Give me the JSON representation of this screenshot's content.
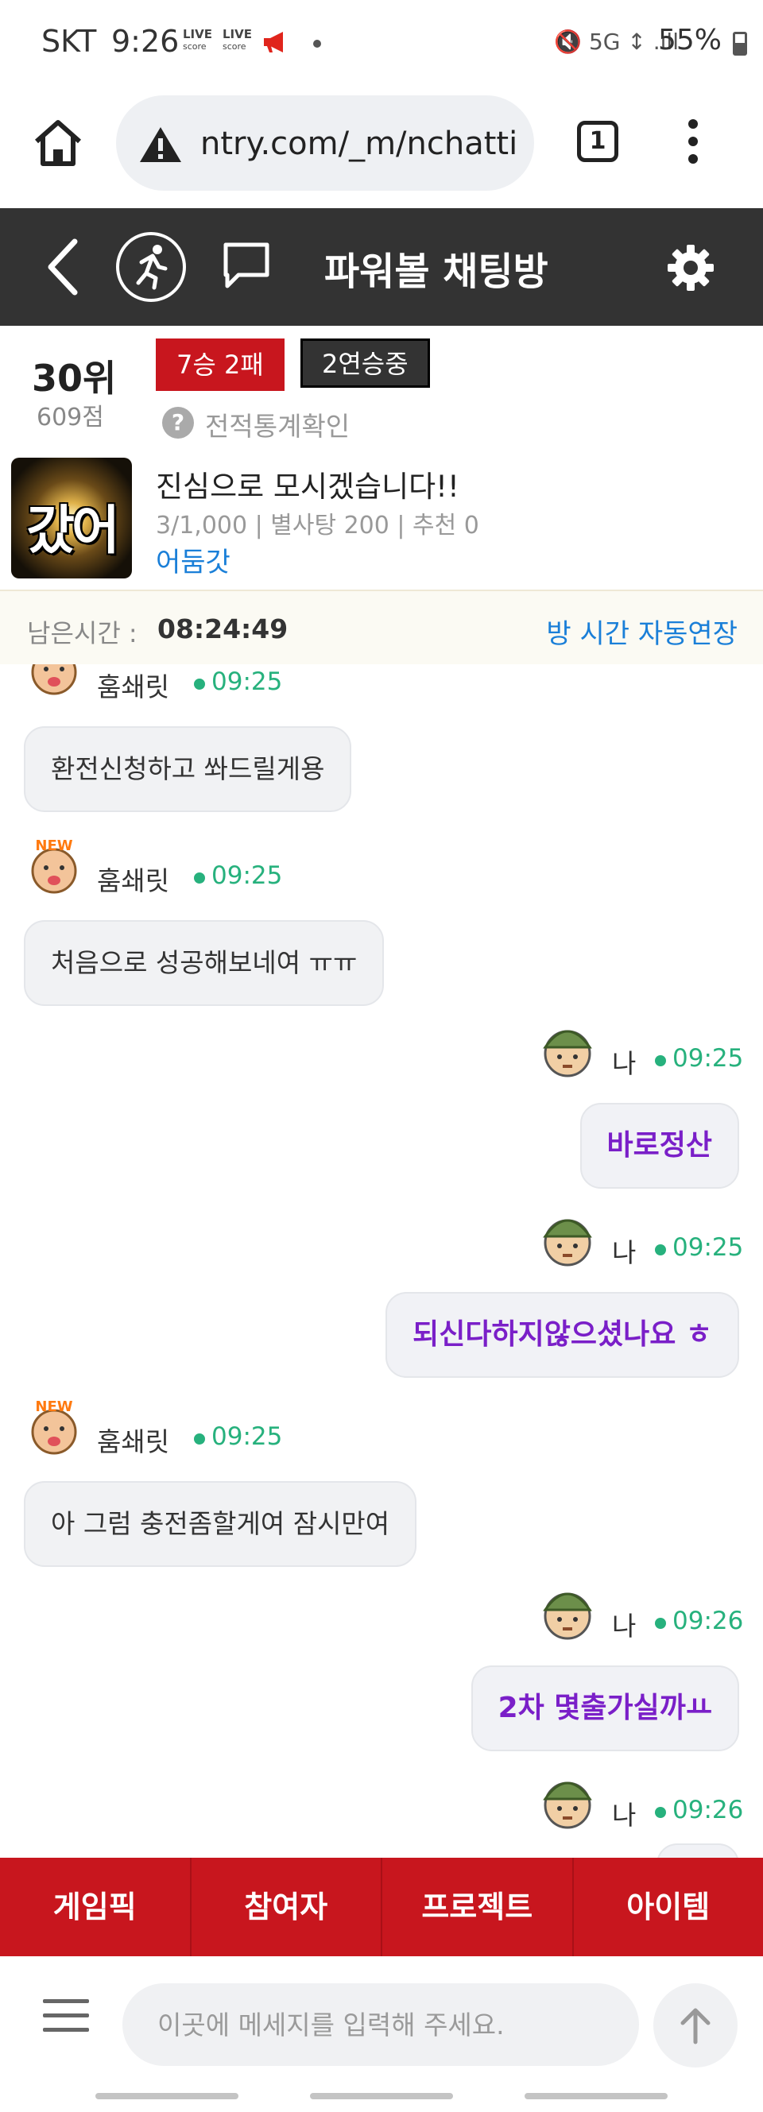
{
  "status_bar": {
    "carrier": "SKT",
    "time": "9:26",
    "live_badges": [
      {
        "top": "LIVE",
        "bottom": "score"
      },
      {
        "top": "LIVE",
        "bottom": "score"
      }
    ],
    "signal_icons": "🔇 5G ↕ .ıll",
    "battery_percent": "55%"
  },
  "browser": {
    "url": "ntry.com/_m/nchatti",
    "tab_count": "1"
  },
  "app_header": {
    "title": "파워볼 채팅방"
  },
  "room": {
    "rank": "30위",
    "points": "609점",
    "record": "7승 2패",
    "streak": "2연승중",
    "stats_link": "전적통계확인",
    "thumbnail_text": "갔어둠",
    "title": "진심으로 모시겠습니다!!",
    "meta": "3/1,000 | 별사탕 200 | 추천 0",
    "owner": "어둠갓"
  },
  "timer": {
    "label": "남은시간 :",
    "value": "08:24:49",
    "extend_label": "방 시간 자동연장"
  },
  "messages": [
    {
      "sender": "훔쇄릿",
      "time": "09:25",
      "text": "환전신청하고 쏴드릴게용",
      "mine": false
    },
    {
      "sender": "훔쇄릿",
      "time": "09:25",
      "text": "처음으로 성공해보네여 ㅠㅠ",
      "mine": false
    },
    {
      "sender": "나",
      "time": "09:25",
      "text": "바로정산",
      "mine": true
    },
    {
      "sender": "나",
      "time": "09:25",
      "text": "되신다하지않으셨나요 ㅎ",
      "mine": true
    },
    {
      "sender": "훔쇄릿",
      "time": "09:25",
      "text": "아 그럼 충전좀할게여 잠시만여",
      "mine": false
    },
    {
      "sender": "나",
      "time": "09:26",
      "text": "2차 몇출가실까ㅛ",
      "mine": true
    },
    {
      "sender": "나",
      "time": "09:26",
      "text": "",
      "mine": true
    }
  ],
  "bottom_tabs": [
    "게임픽",
    "참여자",
    "프로젝트",
    "아이템"
  ],
  "input": {
    "placeholder": "이곳에 메세지를 입력해 주세요.",
    "value": ""
  },
  "colors": {
    "header_bg": "#333333",
    "accent_red": "#c8161e",
    "link_blue": "#1a7fd8",
    "time_green": "#27b17d",
    "my_text_purple": "#7a1fc8"
  }
}
